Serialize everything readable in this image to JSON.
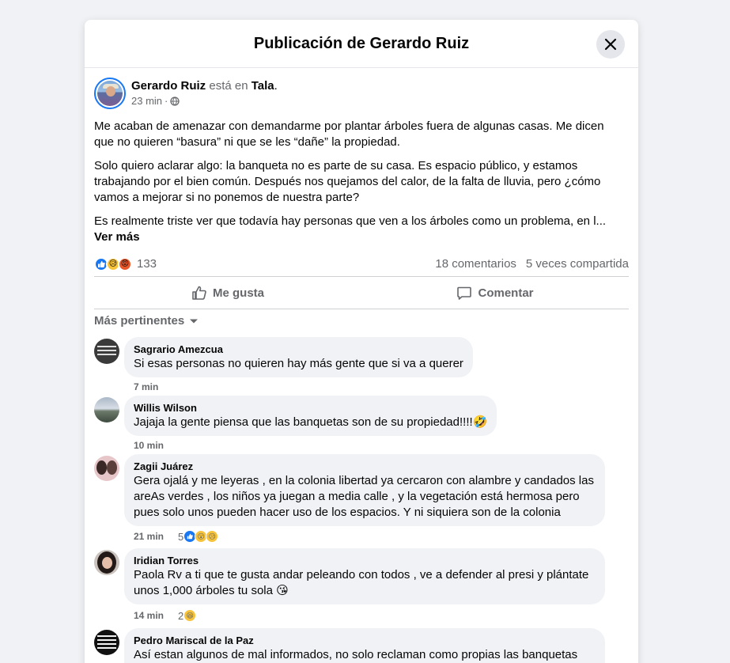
{
  "modal": {
    "title": "Publicación de Gerardo Ruiz"
  },
  "post": {
    "author": "Gerardo Ruiz",
    "at_text": "está en",
    "location": "Tala",
    "time": "23 min",
    "paragraphs": [
      "Me acaban de amenazar con demandarme por plantar árboles fuera de algunas casas. Me dicen que no quieren “basura” ni que se les “dañe” la propiedad.",
      "Solo quiero aclarar algo: la banqueta no es parte de su casa. Es espacio público, y estamos trabajando por el bien común. Después nos quejamos del calor, de la falta de lluvia, pero ¿cómo vamos a mejorar si no ponemos de nuestra parte?"
    ],
    "truncated_paragraph": "Es realmente triste ver que todavía hay personas que ven a los árboles como un problema, en l...",
    "see_more": "Ver más",
    "reaction_count": "133",
    "comments_count": "18 comentarios",
    "shares_count": "5 veces compartida"
  },
  "actions": {
    "like": "Me gusta",
    "comment": "Comentar"
  },
  "filter": {
    "label": "Más pertinentes"
  },
  "comments": [
    {
      "name": "Sagrario Amezcua",
      "text": "Si esas personas no quieren hay más gente que si va a querer",
      "time": "7 min",
      "reactions": ""
    },
    {
      "name": "Willis Wilson",
      "text": "Jajaja la gente piensa que las banquetas son de su propiedad!!!!🤣",
      "time": "10 min",
      "reactions": ""
    },
    {
      "name": "Zagii Juárez",
      "text": "Gera ojalá y me leyeras , en la colonia libertad ya cercaron con alambre y candados las areAs verdes , los niños ya juegan a media calle , y la vegetación está hermosa pero pues solo unos pueden hacer uso de los espacios. Y ni siquiera son de la colonia",
      "time": "21 min",
      "reactions": "5"
    },
    {
      "name": "Iridian Torres",
      "text": "Paola Rv a ti que te gusta andar peleando con todos , ve a defender al presi y plántate unos 1,000 árboles tu sola 😘",
      "time": "14 min",
      "reactions": "2"
    },
    {
      "name": "Pedro Mariscal de la Paz",
      "text": "Así estan algunos de mal informados, no solo reclaman como propias las banquetas también los espacios de estacionamiento frente a los domicilios, cuántos pleitos no han",
      "time": "",
      "reactions": ""
    }
  ]
}
